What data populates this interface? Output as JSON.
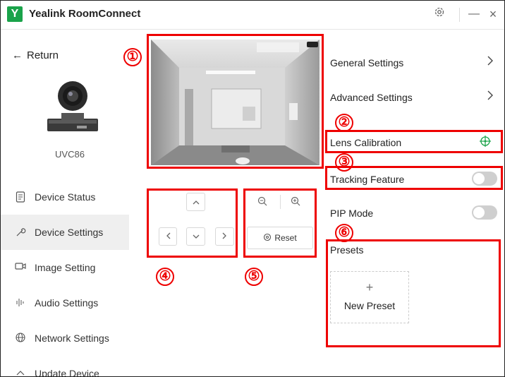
{
  "app": {
    "logo_letter": "Y",
    "title": "Yealink RoomConnect"
  },
  "titlebar": {
    "settings_icon": "gear-icon",
    "minimize": "—",
    "close": "×"
  },
  "sidebar": {
    "return_label": "Return",
    "device_name": "UVC86",
    "items": [
      {
        "label": "Device Status",
        "icon": "document-icon"
      },
      {
        "label": "Device Settings",
        "icon": "wrench-icon",
        "active": true
      },
      {
        "label": "Image Setting",
        "icon": "camera-icon"
      },
      {
        "label": "Audio Settings",
        "icon": "audio-bars-icon"
      },
      {
        "label": "Network Settings",
        "icon": "globe-icon"
      },
      {
        "label": "Update Device",
        "icon": "upload-icon"
      }
    ]
  },
  "callouts": [
    "①",
    "②",
    "③",
    "④",
    "⑤",
    "⑥"
  ],
  "controls": {
    "pan_tilt": {
      "up": "^",
      "down": "v",
      "left": "<",
      "right": ">"
    },
    "zoom": {
      "zoom_out_icon": "zoom-out-icon",
      "zoom_in_icon": "zoom-in-icon",
      "reset_label": "Reset"
    }
  },
  "settings": {
    "general": "General Settings",
    "advanced": "Advanced Settings",
    "lens_calibration": "Lens Calibration",
    "tracking": {
      "label": "Tracking Feature",
      "enabled": false
    },
    "pip": {
      "label": "PIP Mode",
      "enabled": false
    },
    "presets": {
      "label": "Presets",
      "new_preset": "New Preset",
      "plus": "+"
    }
  },
  "colors": {
    "brand": "#1aa34a",
    "highlight": "#e00000",
    "lens_icon": "#1aa34a"
  }
}
